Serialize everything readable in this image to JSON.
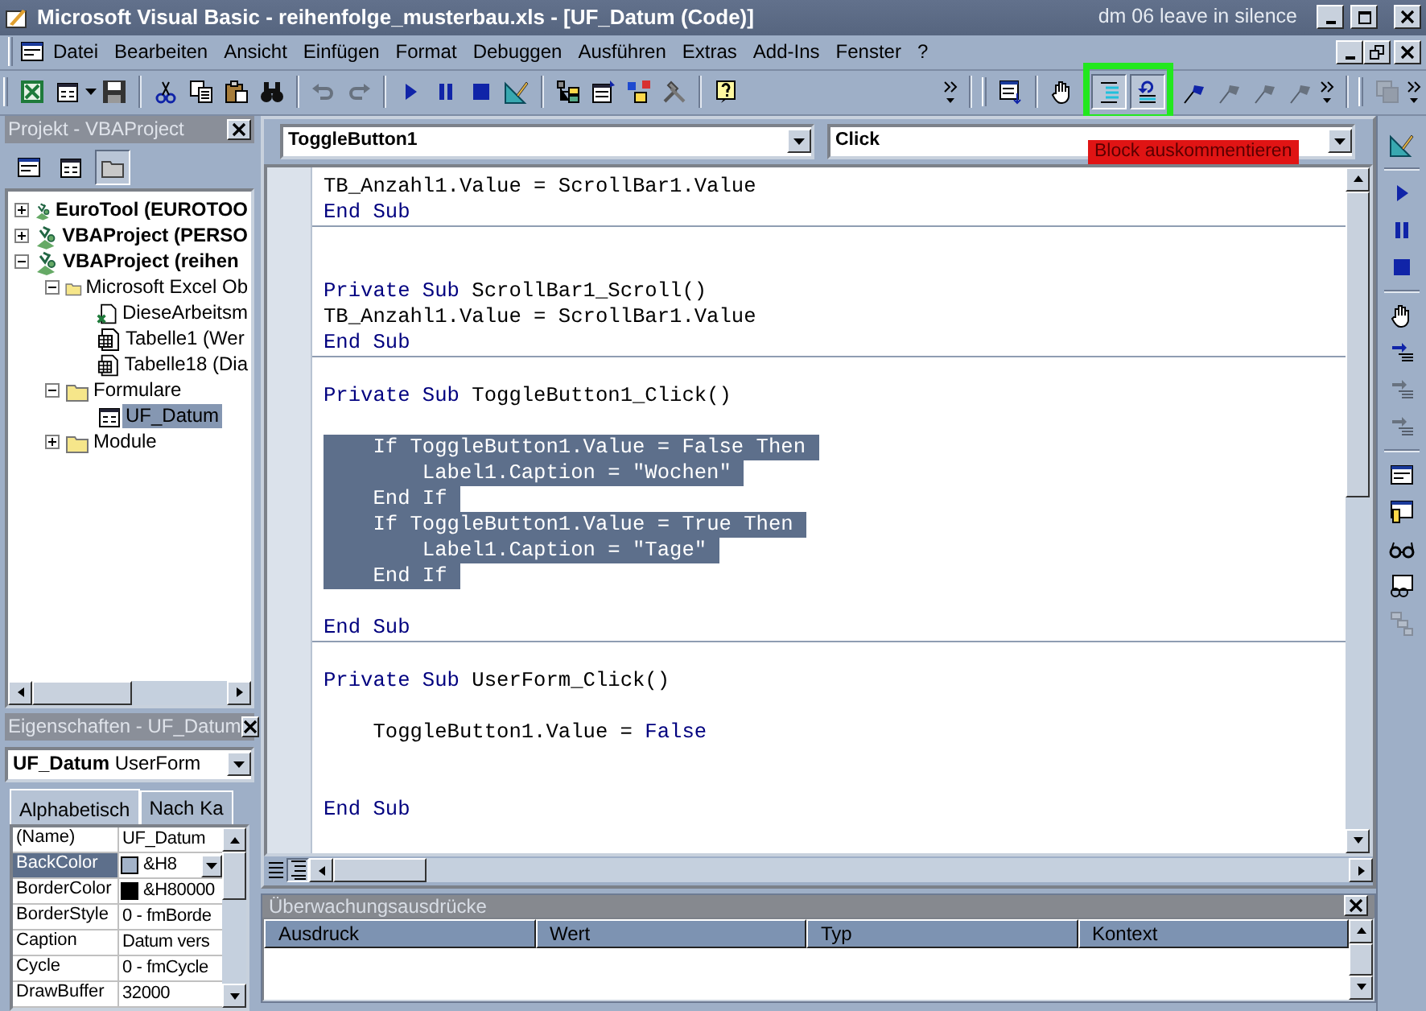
{
  "window": {
    "title": "Microsoft Visual Basic - reihenfolge_musterbau.xls - [UF_Datum (Code)]",
    "caption_note": "dm 06 leave in silence"
  },
  "menu": [
    "Datei",
    "Bearbeiten",
    "Ansicht",
    "Einfügen",
    "Format",
    "Debuggen",
    "Ausführen",
    "Extras",
    "Add-Ins",
    "Fenster",
    "?"
  ],
  "toolbars": [
    {
      "groups": [
        [
          {
            "disabled": false,
            "highlighted": false
          },
          {
            "disabled": false,
            "highlighted": false
          },
          {
            "disabled": false,
            "highlighted": false
          }
        ],
        [
          {
            "disabled": false,
            "highlighted": false
          },
          {
            "disabled": false,
            "highlighted": false
          },
          {
            "disabled": false,
            "highlighted": false
          },
          {
            "disabled": false,
            "highlighted": false
          }
        ],
        [
          {
            "disabled": true,
            "highlighted": false
          },
          {
            "disabled": true,
            "highlighted": false
          }
        ],
        [
          {
            "disabled": false,
            "highlighted": false
          },
          {
            "disabled": false,
            "highlighted": false
          },
          {
            "disabled": false,
            "highlighted": false
          },
          {
            "disabled": false,
            "highlighted": false
          }
        ],
        [
          {
            "disabled": false,
            "highlighted": false
          },
          {
            "disabled": false,
            "highlighted": false
          },
          {
            "disabled": false,
            "highlighted": false
          },
          {
            "disabled": false,
            "highlighted": false
          }
        ],
        [
          {
            "disabled": false,
            "highlighted": false
          }
        ]
      ]
    },
    {
      "groups": [
        [
          {
            "disabled": false,
            "highlighted": false
          }
        ],
        [
          {
            "disabled": false,
            "highlighted": false
          },
          {
            "disabled": false,
            "highlighted": true
          },
          {
            "disabled": false,
            "highlighted": true
          },
          {
            "disabled": false,
            "highlighted": false
          },
          {
            "disabled": true,
            "highlighted": false
          },
          {
            "disabled": true,
            "highlighted": false
          },
          {
            "disabled": true,
            "highlighted": false
          }
        ]
      ]
    },
    {
      "groups": [
        [
          {
            "disabled": true,
            "highlighted": false
          }
        ]
      ]
    }
  ],
  "tooltip": "Block auskommentieren",
  "project_explorer": {
    "title": "Projekt - VBAProject",
    "buttons": [
      {
        "pressed": false
      },
      {
        "pressed": false
      },
      {
        "pressed": true
      }
    ],
    "tree": [
      {
        "label": "EuroTool (EUROTOO",
        "kind": "project",
        "expanded": false,
        "selected": false
      },
      {
        "label": "VBAProject (PERSO",
        "kind": "project",
        "expanded": false,
        "selected": false
      },
      {
        "label": "VBAProject (reihen",
        "kind": "project",
        "expanded": true,
        "selected": false,
        "children": [
          {
            "label": "Microsoft Excel Ob",
            "kind": "folder",
            "expanded": true,
            "selected": false,
            "children": [
              {
                "label": "DieseArbeitsm",
                "kind": "workbook",
                "selected": false
              },
              {
                "label": "Tabelle1 (Wer",
                "kind": "sheet",
                "selected": false
              },
              {
                "label": "Tabelle18 (Dia",
                "kind": "sheet",
                "selected": false
              }
            ]
          },
          {
            "label": "Formulare",
            "kind": "folder",
            "expanded": true,
            "selected": false,
            "children": [
              {
                "label": "UF_Datum",
                "kind": "form",
                "selected": true
              }
            ]
          },
          {
            "label": "Module",
            "kind": "folder",
            "expanded": false,
            "selected": false
          }
        ]
      }
    ]
  },
  "properties": {
    "title": "Eigenschaften - UF_Datum",
    "object_name": "UF_Datum",
    "object_type": "UserForm",
    "tabs": [
      {
        "label": "Alphabetisch",
        "selected": true
      },
      {
        "label": "Nach Ka",
        "selected": false
      }
    ],
    "rows": [
      {
        "name": "(Name)",
        "value": "UF_Datum",
        "selected": false
      },
      {
        "name": "BackColor",
        "value": "&H8",
        "color": "#a3b3c9",
        "selected": true
      },
      {
        "name": "BorderColor",
        "value": "&H80000",
        "color": "#000000",
        "selected": false
      },
      {
        "name": "BorderStyle",
        "value": "0 - fmBorde",
        "selected": false
      },
      {
        "name": "Caption",
        "value": "Datum vers",
        "selected": false
      },
      {
        "name": "Cycle",
        "value": "0 - fmCycle",
        "selected": false
      },
      {
        "name": "DrawBuffer",
        "value": "32000",
        "selected": false
      }
    ]
  },
  "code_window": {
    "object_combo": "ToggleButton1",
    "procedure_combo": "Click",
    "procedures": [
      {
        "lines": [
          {
            "tokens": [
              {
                "text": "TB_Anzahl1.Value = ScrollBar1.Value",
                "kind": "plain"
              }
            ],
            "selected": false
          },
          {
            "tokens": [
              {
                "text": "End Sub",
                "kind": "keyword"
              }
            ],
            "selected": false
          }
        ]
      },
      {
        "lines": [
          {
            "kind": "blank"
          },
          {
            "kind": "blank"
          },
          {
            "tokens": [
              {
                "text": "Private Sub",
                "kind": "keyword"
              },
              {
                "text": " ScrollBar1_Scroll()",
                "kind": "plain"
              }
            ],
            "selected": false
          },
          {
            "tokens": [
              {
                "text": "TB_Anzahl1.Value = ScrollBar1.Value",
                "kind": "plain"
              }
            ],
            "selected": false
          },
          {
            "tokens": [
              {
                "text": "End Sub",
                "kind": "keyword"
              }
            ],
            "selected": false
          }
        ]
      },
      {
        "lines": [
          {
            "kind": "blank"
          },
          {
            "tokens": [
              {
                "text": "Private Sub",
                "kind": "keyword"
              },
              {
                "text": " ToggleButton1_Click()",
                "kind": "plain"
              }
            ],
            "selected": false
          },
          {
            "kind": "blank"
          },
          {
            "tokens": [
              {
                "text": "    If",
                "kind": "keyword"
              },
              {
                "text": " ToggleButton1.Value = ",
                "kind": "plain"
              },
              {
                "text": "False",
                "kind": "keyword"
              },
              {
                "text": " Then",
                "kind": "keyword"
              }
            ],
            "selected": true
          },
          {
            "tokens": [
              {
                "text": "        Label1.Caption = \"Wochen\"",
                "kind": "plain"
              }
            ],
            "selected": true
          },
          {
            "tokens": [
              {
                "text": "    End If",
                "kind": "keyword"
              }
            ],
            "selected": true
          },
          {
            "tokens": [
              {
                "text": "    If",
                "kind": "keyword"
              },
              {
                "text": " ToggleButton1.Value = ",
                "kind": "plain"
              },
              {
                "text": "True",
                "kind": "keyword"
              },
              {
                "text": " Then",
                "kind": "keyword"
              }
            ],
            "selected": true
          },
          {
            "tokens": [
              {
                "text": "        Label1.Caption = \"Tage\"",
                "kind": "plain"
              }
            ],
            "selected": true
          },
          {
            "tokens": [
              {
                "text": "    End If",
                "kind": "keyword"
              }
            ],
            "selected": true
          },
          {
            "kind": "blank"
          },
          {
            "tokens": [
              {
                "text": "End Sub",
                "kind": "keyword"
              }
            ],
            "selected": false
          }
        ]
      },
      {
        "lines": [
          {
            "kind": "blank"
          },
          {
            "tokens": [
              {
                "text": "Private Sub",
                "kind": "keyword"
              },
              {
                "text": " UserForm_Click()",
                "kind": "plain"
              }
            ],
            "selected": false
          },
          {
            "kind": "blank"
          },
          {
            "tokens": [
              {
                "text": "    ToggleButton1.Value = ",
                "kind": "plain"
              },
              {
                "text": "False",
                "kind": "keyword"
              }
            ],
            "selected": false
          },
          {
            "kind": "blank"
          },
          {
            "kind": "blank"
          },
          {
            "tokens": [
              {
                "text": "End Sub",
                "kind": "keyword"
              }
            ],
            "selected": false
          }
        ]
      }
    ]
  },
  "side_toolbar": {
    "groups": [
      [
        {
          "disabled": false
        }
      ],
      [
        {
          "disabled": false
        },
        {
          "disabled": false
        },
        {
          "disabled": false
        }
      ],
      [
        {
          "disabled": false
        },
        {
          "disabled": false
        },
        {
          "disabled": true
        },
        {
          "disabled": true
        }
      ],
      [
        {
          "disabled": false
        },
        {
          "disabled": false
        },
        {
          "disabled": false
        },
        {
          "disabled": false
        },
        {
          "disabled": true
        }
      ]
    ]
  },
  "watch": {
    "title": "Überwachungsausdrücke",
    "columns": [
      "Ausdruck",
      "Wert",
      "Typ",
      "Kontext"
    ]
  }
}
